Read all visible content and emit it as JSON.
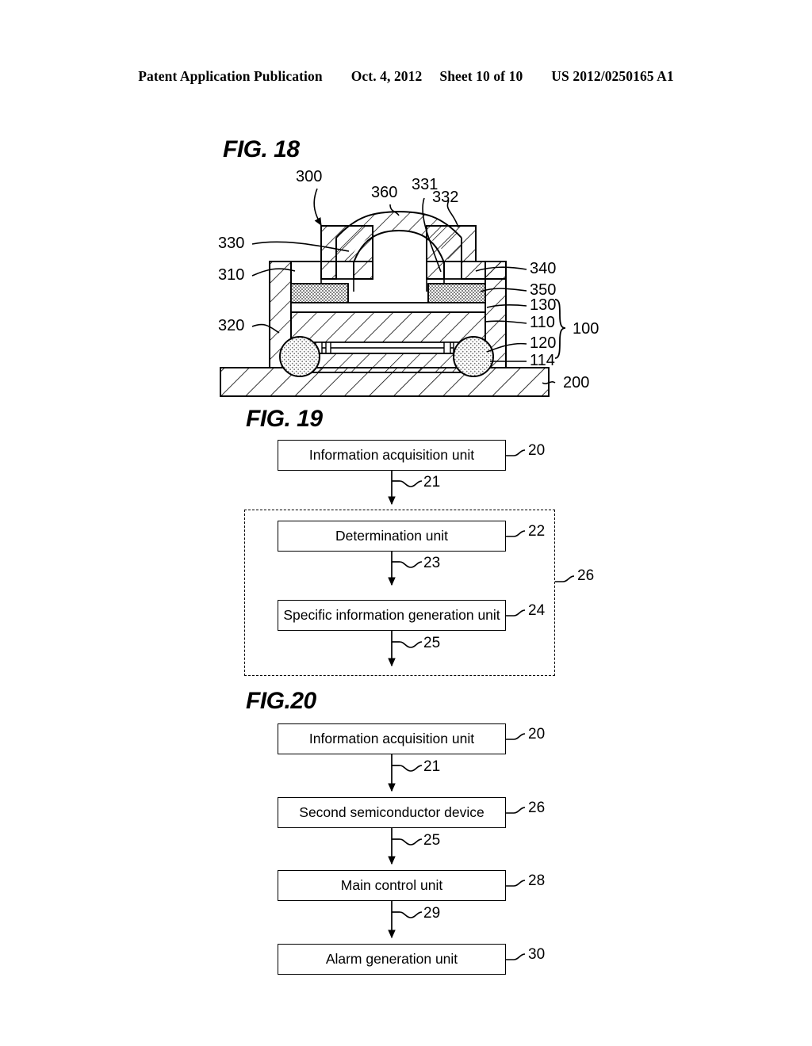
{
  "header": {
    "publication": "Patent Application Publication",
    "date": "Oct. 4, 2012",
    "sheet": "Sheet 10 of 10",
    "docnum": "US 2012/0250165 A1"
  },
  "figures": [
    {
      "id": "fig18",
      "title": "FIG. 18",
      "type": "cross-section-diagram",
      "description": "Cross sectional view of a semiconductor device package mounted on a board",
      "callouts": [
        {
          "label": "300",
          "side": "top-left",
          "target": "package-cap"
        },
        {
          "label": "360",
          "side": "top",
          "target": "lens-dome"
        },
        {
          "label": "331",
          "side": "top",
          "target": "inner-step"
        },
        {
          "label": "332",
          "side": "top",
          "target": "outer-cap-wall"
        },
        {
          "label": "330",
          "side": "left",
          "target": "cap-body"
        },
        {
          "label": "310",
          "side": "left",
          "target": "frame-upper"
        },
        {
          "label": "320",
          "side": "left",
          "target": "frame-lower"
        },
        {
          "label": "340",
          "side": "right",
          "target": "top-plate"
        },
        {
          "label": "350",
          "side": "right",
          "target": "adhesive-pad"
        },
        {
          "label": "130",
          "side": "right",
          "target": "layer-130"
        },
        {
          "label": "110",
          "side": "right",
          "target": "layer-110"
        },
        {
          "label": "120",
          "side": "right",
          "target": "layer-120"
        },
        {
          "label": "114",
          "side": "right",
          "target": "layer-114"
        },
        {
          "label": "100",
          "side": "right",
          "target": "first-semiconductor-device"
        },
        {
          "label": "200",
          "side": "right",
          "target": "mounting-board"
        }
      ]
    },
    {
      "id": "fig19",
      "title": "FIG. 19",
      "type": "block-flow-diagram",
      "blocks": [
        {
          "label": "Information acquisition unit",
          "ref": "20",
          "in_group": false
        },
        {
          "label": "Determination unit",
          "ref": "22",
          "in_group": true
        },
        {
          "label": "Specific information generation unit",
          "ref": "24",
          "in_group": true
        }
      ],
      "arrows": [
        {
          "ref": "21"
        },
        {
          "ref": "23"
        },
        {
          "ref": "25"
        }
      ],
      "group": {
        "ref": "26",
        "style": "dashed"
      }
    },
    {
      "id": "fig20",
      "title": "FIG.20",
      "type": "block-flow-diagram",
      "blocks": [
        {
          "label": "Information acquisition unit",
          "ref": "20"
        },
        {
          "label": "Second semiconductor device",
          "ref": "26"
        },
        {
          "label": "Main control unit",
          "ref": "28"
        },
        {
          "label": "Alarm generation unit",
          "ref": "30"
        }
      ],
      "arrows": [
        {
          "ref": "21"
        },
        {
          "ref": "25"
        },
        {
          "ref": "29"
        }
      ]
    }
  ]
}
